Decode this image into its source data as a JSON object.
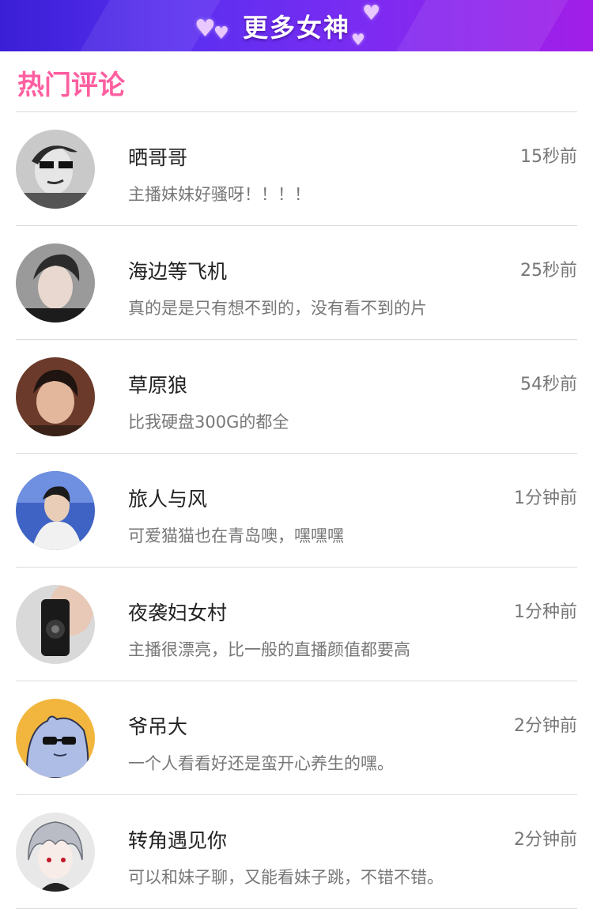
{
  "banner": {
    "title": "更多女神"
  },
  "section": {
    "title": "热门评论"
  },
  "comments": [
    {
      "name": "晒哥哥",
      "time": "15秒前",
      "text": "主播妹妹好骚呀！！！！"
    },
    {
      "name": "海边等飞机",
      "time": "25秒前",
      "text": "真的是是只有想不到的，没有看不到的片"
    },
    {
      "name": "草原狼",
      "time": "54秒前",
      "text": "比我硬盘300G的都全"
    },
    {
      "name": "旅人与风",
      "time": "1分钟前",
      "text": "可爱猫猫也在青岛噢，嘿嘿嘿"
    },
    {
      "name": " 夜袭妇女村",
      "time": "1分种前",
      "text": "主播很漂亮，比一般的直播颜值都要高"
    },
    {
      "name": "爷吊大",
      "time": "2分钟前",
      "text": "一个人看看好还是蛮开心养生的嘿。"
    },
    {
      "name": "转角遇见你",
      "time": "2分钟前",
      "text": "可以和妹子聊，又能看妹子跳，不错不错。"
    }
  ],
  "colors": {
    "banner_start": "#3a1fd6",
    "banner_end": "#a21ee8",
    "section_title": "#ff5fa0",
    "name_text": "#222222",
    "secondary_text": "#777777",
    "divider": "#dcdcdc"
  }
}
